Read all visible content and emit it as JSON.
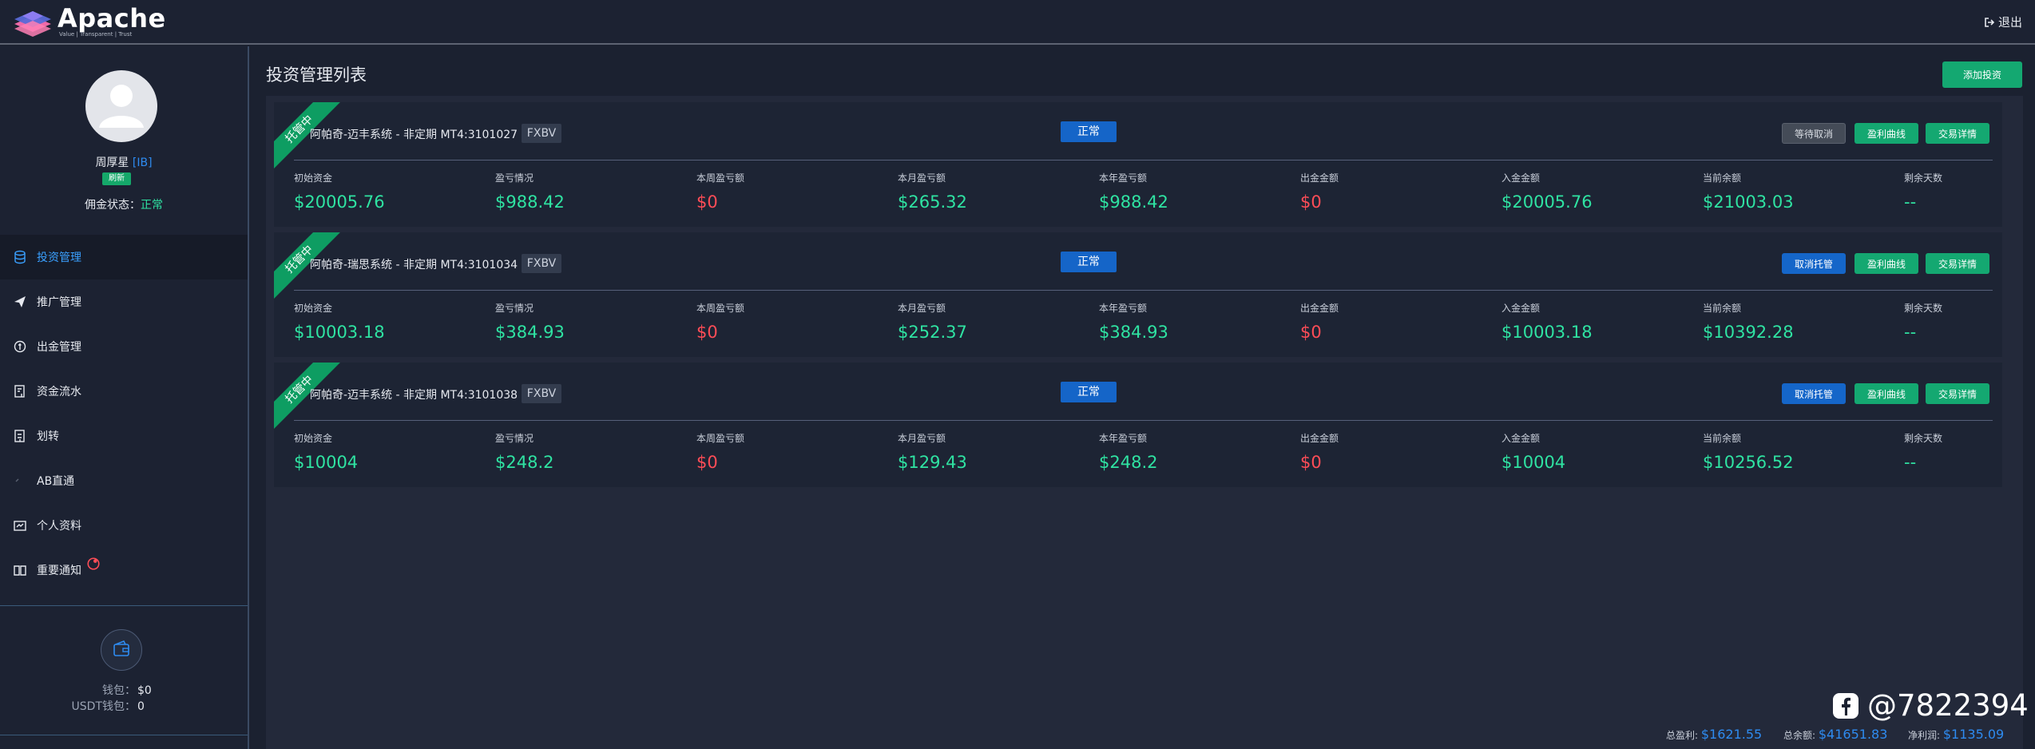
{
  "header": {
    "brand": "Apache",
    "tagline": "Value | Transparent | Trust",
    "logout_label": "退出"
  },
  "sidebar": {
    "user_name": "周厚星",
    "user_role": "[IB]",
    "refresh_label": "刷新",
    "commission_label": "佣金状态：",
    "commission_value": "正常",
    "items": [
      {
        "label": "投资管理",
        "icon": "database-icon",
        "active": true
      },
      {
        "label": "推广管理",
        "icon": "send-icon",
        "active": false
      },
      {
        "label": "出金管理",
        "icon": "coin-icon",
        "active": false
      },
      {
        "label": "资金流水",
        "icon": "ledger-icon",
        "active": false
      },
      {
        "label": "划转",
        "icon": "transfer-icon",
        "active": false
      },
      {
        "label": "AB直通",
        "icon": "link-icon",
        "active": false
      },
      {
        "label": "个人资料",
        "icon": "profile-card-icon",
        "active": false
      },
      {
        "label": "重要通知",
        "icon": "book-icon",
        "active": false
      }
    ],
    "wallet_label": "钱包：",
    "wallet_value": "$0",
    "usdt_wallet_label": "USDT钱包：",
    "usdt_wallet_value": "0"
  },
  "main": {
    "title": "投资管理列表",
    "add_button": "添加投资",
    "cards": [
      {
        "ribbon": "托管中",
        "title": "阿帕奇-迈丰系统 - 非定期 MT4:3101027",
        "tag": "FXBV",
        "status": "正常",
        "first_button": "等待取消",
        "curve_button": "盈利曲线",
        "detail_button": "交易详情",
        "stats": [
          {
            "label": "初始资金",
            "value": "$20005.76"
          },
          {
            "label": "盈亏情况",
            "value": "$988.42"
          },
          {
            "label": "本周盈亏额",
            "value": "$0"
          },
          {
            "label": "本月盈亏额",
            "value": "$265.32"
          },
          {
            "label": "本年盈亏额",
            "value": "$988.42"
          },
          {
            "label": "出金金额",
            "value": "$0"
          },
          {
            "label": "入金金额",
            "value": "$20005.76"
          },
          {
            "label": "当前余额",
            "value": "$21003.03"
          },
          {
            "label": "剩余天数",
            "value": "--"
          }
        ]
      },
      {
        "ribbon": "托管中",
        "title": "阿帕奇-瑞思系统 - 非定期 MT4:3101034",
        "tag": "FXBV",
        "status": "正常",
        "first_button": "取消托管",
        "curve_button": "盈利曲线",
        "detail_button": "交易详情",
        "stats": [
          {
            "label": "初始资金",
            "value": "$10003.18"
          },
          {
            "label": "盈亏情况",
            "value": "$384.93"
          },
          {
            "label": "本周盈亏额",
            "value": "$0"
          },
          {
            "label": "本月盈亏额",
            "value": "$252.37"
          },
          {
            "label": "本年盈亏额",
            "value": "$384.93"
          },
          {
            "label": "出金金额",
            "value": "$0"
          },
          {
            "label": "入金金额",
            "value": "$10003.18"
          },
          {
            "label": "当前余额",
            "value": "$10392.28"
          },
          {
            "label": "剩余天数",
            "value": "--"
          }
        ]
      },
      {
        "ribbon": "托管中",
        "title": "阿帕奇-迈丰系统 - 非定期 MT4:3101038",
        "tag": "FXBV",
        "status": "正常",
        "first_button": "取消托管",
        "curve_button": "盈利曲线",
        "detail_button": "交易详情",
        "stats": [
          {
            "label": "初始资金",
            "value": "$10004"
          },
          {
            "label": "盈亏情况",
            "value": "$248.2"
          },
          {
            "label": "本周盈亏额",
            "value": "$0"
          },
          {
            "label": "本月盈亏额",
            "value": "$129.43"
          },
          {
            "label": "本年盈亏额",
            "value": "$248.2"
          },
          {
            "label": "出金金额",
            "value": "$0"
          },
          {
            "label": "入金金额",
            "value": "$10004"
          },
          {
            "label": "当前余额",
            "value": "$10256.52"
          },
          {
            "label": "剩余天数",
            "value": "--"
          }
        ]
      }
    ]
  },
  "summary": {
    "total_profit_label": "总盈利:",
    "total_profit": "$1621.55",
    "total_balance_label": "总余额:",
    "total_balance": "$41651.83",
    "net_profit_label": "净利润:",
    "net_profit": "$1135.09"
  },
  "watermark": {
    "handle": "@7822394",
    "icon": "facebook-icon"
  },
  "colors": {
    "accent_green": "#14a871",
    "accent_blue": "#1565c8",
    "positive": "#2fe3a2",
    "negative": "#ff4d57",
    "link_blue": "#2e8bf0"
  }
}
